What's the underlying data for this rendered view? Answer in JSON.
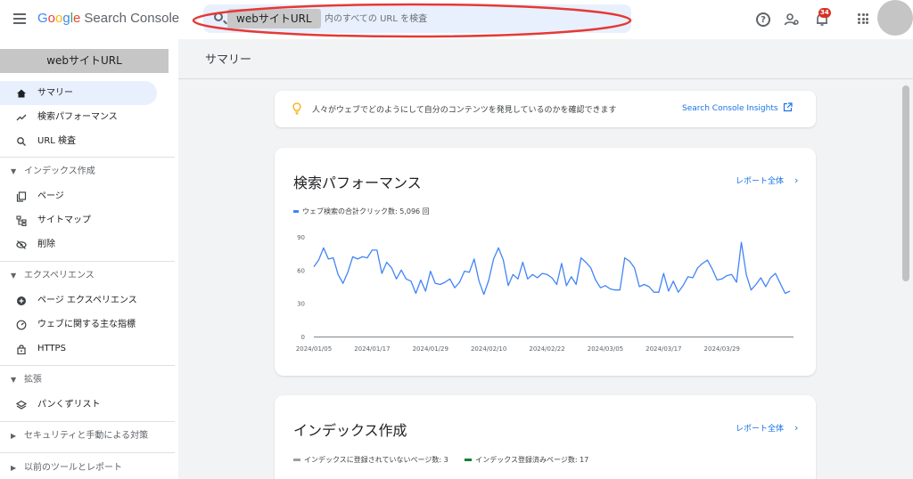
{
  "header": {
    "logo": {
      "G": "G",
      "o1": "o",
      "o2": "o",
      "g": "g",
      "l": "l",
      "e": "e",
      "product": "Search Console"
    },
    "search": {
      "property_chip": "webサイトURL",
      "placeholder": "内のすべての URL を検査"
    },
    "notifications_count": "34"
  },
  "sidebar": {
    "property": "webサイトURL",
    "items": [
      {
        "label": "サマリー",
        "icon": "home-icon",
        "active": true
      },
      {
        "label": "検索パフォーマンス",
        "icon": "trending-icon"
      },
      {
        "label": "URL 検査",
        "icon": "search-icon"
      }
    ],
    "sections": [
      {
        "label": "インデックス作成",
        "items": [
          {
            "label": "ページ",
            "icon": "pages-icon"
          },
          {
            "label": "サイトマップ",
            "icon": "sitemap-icon"
          },
          {
            "label": "削除",
            "icon": "eye-off-icon"
          }
        ]
      },
      {
        "label": "エクスペリエンス",
        "items": [
          {
            "label": "ページ エクスペリエンス",
            "icon": "plus-circle-icon"
          },
          {
            "label": "ウェブに関する主な指標",
            "icon": "speed-icon"
          },
          {
            "label": "HTTPS",
            "icon": "lock-icon"
          }
        ]
      },
      {
        "label": "拡張",
        "items": [
          {
            "label": "パンくずリスト",
            "icon": "layers-icon"
          }
        ]
      },
      {
        "label": "セキュリティと手動による対策",
        "items": []
      },
      {
        "label": "以前のツールとレポート",
        "items": []
      }
    ]
  },
  "main": {
    "title": "サマリー",
    "insight": {
      "text": "人々がウェブでどのようにして自分のコンテンツを発見しているのかを確認できます",
      "link": "Search Console Insights"
    },
    "performance": {
      "title": "検索パフォーマンス",
      "report_link": "レポート全体",
      "legend": "ウェブ検索の合計クリック数: 5,096 回"
    },
    "indexing": {
      "title": "インデックス作成",
      "report_link": "レポート全体",
      "legend_not_indexed": "インデックスに登録されていないページ数: 3",
      "legend_indexed": "インデックス登録済みページ数: 17"
    }
  },
  "colors": {
    "accent": "#1a73e8",
    "series": "#4285f4",
    "not_indexed": "#9aa0a6",
    "indexed": "#188038",
    "annotation": "#e53935"
  },
  "chart_data": {
    "type": "line",
    "ylim": [
      0,
      90
    ],
    "yticks": [
      "0",
      "30",
      "60",
      "90"
    ],
    "xtick_labels": [
      "2024/01/05",
      "2024/01/17",
      "2024/01/29",
      "2024/02/10",
      "2024/02/22",
      "2024/03/05",
      "2024/03/17",
      "2024/03/29"
    ],
    "series": [
      {
        "name": "ウェブ検索の合計クリック数",
        "values": [
          63,
          69,
          80,
          70,
          71,
          56,
          48,
          58,
          72,
          70,
          72,
          71,
          78,
          78,
          57,
          67,
          62,
          52,
          60,
          52,
          50,
          39,
          51,
          41,
          59,
          48,
          47,
          49,
          52,
          44,
          49,
          59,
          58,
          70,
          50,
          38,
          51,
          70,
          80,
          69,
          46,
          56,
          52,
          67,
          52,
          56,
          53,
          57,
          56,
          53,
          47,
          66,
          46,
          54,
          47,
          71,
          67,
          62,
          51,
          44,
          46,
          43,
          42,
          42,
          71,
          68,
          62,
          45,
          47,
          45,
          40,
          40,
          57,
          41,
          50,
          40,
          46,
          54,
          53,
          62,
          66,
          69,
          61,
          51,
          52,
          55,
          56,
          49,
          85,
          56,
          42,
          47,
          53,
          45,
          53,
          57,
          48,
          39,
          41
        ]
      }
    ]
  }
}
